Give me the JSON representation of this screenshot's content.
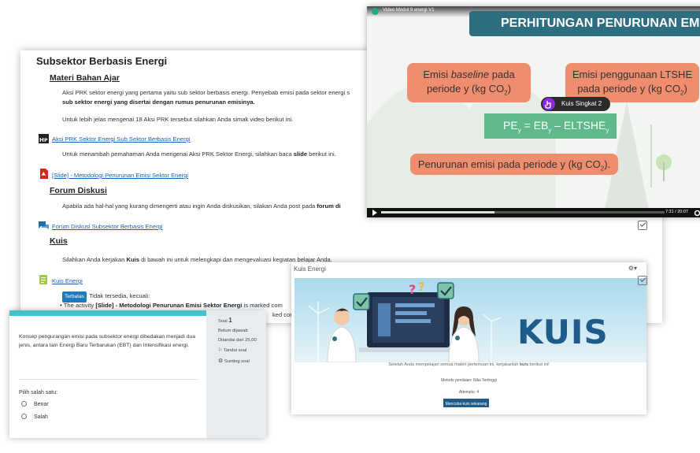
{
  "course": {
    "section_title": "Subsektor Berbasis Energi",
    "materi_heading": "Materi Bahan Ajar",
    "intro_line1": "Aksi PRK sektor energi yang pertama yaitu sub sektor berbasis energi. Penyebab emisi pada sektor energi s",
    "intro_line2_bold": "sub sektor energi yang disertai dengan rumus penurunan emisinya.",
    "video_prompt": "Untuk lebih jelas mengenai 18 Aksi PRK tersebut silahkan Anda simak video berikut ini.",
    "h5p_link": "Aksi PRK Sektor Energi Sub Sektor Berbasis Energi",
    "slide_prompt_pre": "Untuk menambah pemahaman Anda mengenai Aksi PRK Sektor Energi, silahkan baca ",
    "slide_prompt_bold": "slide",
    "slide_prompt_post": " berikut ini.",
    "slide_link": "[Slide] - Metodologi Penurunan Emisi Sektor Energi",
    "forum_heading": "Forum Diskusi",
    "forum_prompt_pre": "Apabila ada hal-hal yang kurang dimengerti atau ingin Anda diskusikan, silakan Anda post pada ",
    "forum_prompt_bold": "forum di",
    "forum_link": "Forum Diskusi Subsektor Berbasis Energi",
    "kuis_heading": "Kuis",
    "kuis_prompt_pre": "Silahkan Anda kerjakan ",
    "kuis_prompt_bold": "Kuis",
    "kuis_prompt_post": " di bawah ini untuk melengkapi dan mengevaluasi kegiatan belajar Anda.",
    "kuis_link": "Kuis Energi",
    "restricted_badge": "Terbatas",
    "restricted_text": "Tidak tersedia, kecuali:",
    "restriction_pre": "The activity ",
    "restriction_bold": "[Slide] - Metodologi Penurunan Emisi Sektor Energi",
    "restriction_post": " is marked com",
    "restriction_tail": "ked com"
  },
  "video": {
    "title": "Video Modul 9 energi V1",
    "banner": "PERHITUNGAN PENURUNAN EMI",
    "bubble_baseline_a": "Emisi ",
    "bubble_baseline_italic": "baseline",
    "bubble_baseline_b": " pada",
    "bubble_baseline_line2": "periode y (kg CO",
    "bubble_baseline_sub": "2",
    "bubble_baseline_end": ")",
    "bubble_ltshe_line1": "Emisi penggunaan LTSHE",
    "bubble_ltshe_line2": "pada periode y (kg CO",
    "bubble_ltshe_sub": "2",
    "bubble_ltshe_end": ")",
    "formula_pe": "PE",
    "formula_eq": " = EB",
    "formula_minus": " – ELTSHE",
    "formula_sub": "y",
    "bubble_reduction": "Penurunan emisi pada periode y (kg CO",
    "bubble_reduction_sub": "2",
    "bubble_reduction_end": ").",
    "quiz_pill": "Kuis Singkat 2",
    "time": "7:31 / 20:07",
    "progress": 0.4
  },
  "question": {
    "text": "Konsep pengurangan emisi pada subsektor energi dibedakan menjadi dua jenis, antara lain Energi Baru Terbarukan (EBT) dan Intensifikasi energi.",
    "prompt": "Pilih salah satu:",
    "options": [
      "Benar",
      "Salah"
    ],
    "soal_label": "Soal",
    "soal_number": "1",
    "status": "Belum dijawab",
    "marks": "Ditandai dari 25,00",
    "flag": "Tandai soal",
    "edit": "Sunting soal"
  },
  "kuis": {
    "title": "Kuis Energi",
    "banner_word": "KUIS",
    "intro_pre": "Setelah Anda mempelajari semua materi pertemuan ini, kerjakanlah ",
    "intro_bold": "kuis",
    "intro_post": " berikut ini!",
    "method": "Metode penilaian: Nilai Tertinggi",
    "attempts": "Attempts: 4",
    "start_button": "Mencoba kuis sekarang"
  },
  "colors": {
    "link": "#1a5fb4",
    "accent_teal": "#46c2cc",
    "bubble_orange": "#f08d6e",
    "formula_green": "#5fb98b",
    "banner_teal": "#2d6e80",
    "kuis_blue": "#1f5c8a"
  }
}
